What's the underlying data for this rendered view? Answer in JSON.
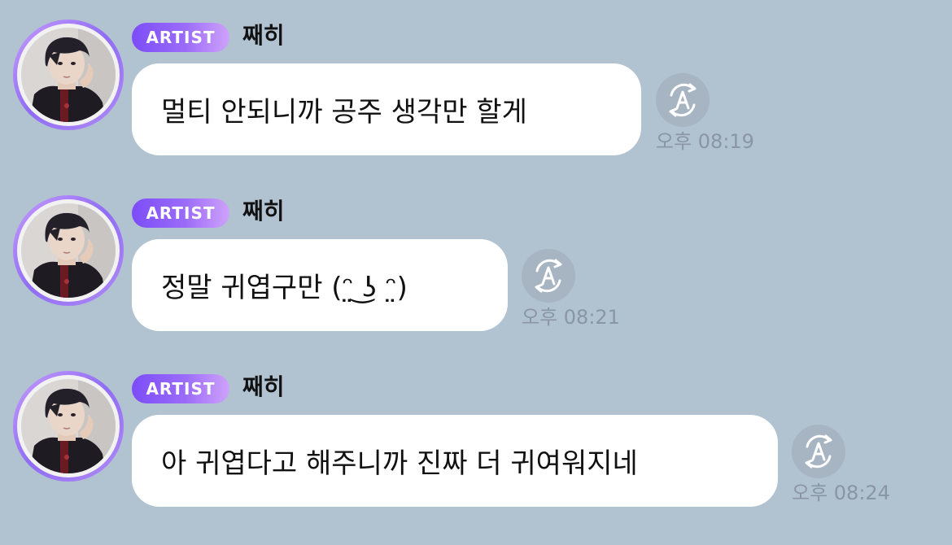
{
  "messages": [
    {
      "badge": "ARTIST",
      "sender": "째히",
      "text": "멀티 안되니까 공주 생각만 할게",
      "time": "오후 08:19",
      "avatar": "profile-photo",
      "translate_icon": "translate-icon"
    },
    {
      "badge": "ARTIST",
      "sender": "째히",
      "text": "정말 귀엽구만 (ᵔ̤ ͜ʖ ᵔ̤)",
      "time": "오후 08:21",
      "avatar": "profile-photo",
      "translate_icon": "translate-icon"
    },
    {
      "badge": "ARTIST",
      "sender": "째히",
      "text": "아 귀엽다고 해주니까 진짜 더 귀여워지네",
      "time": "오후 08:24",
      "avatar": "profile-photo",
      "translate_icon": "translate-icon"
    }
  ],
  "colors": {
    "background": "#b1c2d1",
    "bubble": "#ffffff",
    "badge_start": "#7c4df7",
    "badge_end": "#cfa2fb",
    "time_text": "#8a96a3",
    "translate_button": "#a7b4c2"
  }
}
